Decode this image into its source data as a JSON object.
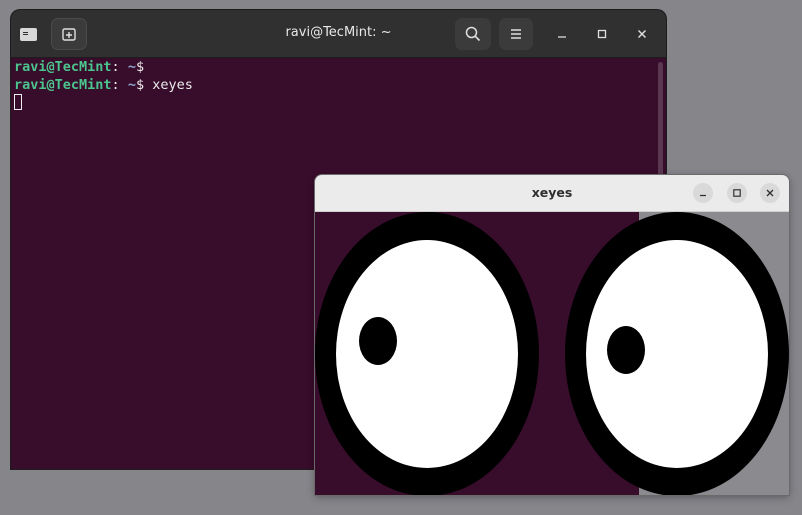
{
  "terminal": {
    "title": "ravi@TecMint: ~",
    "lines": [
      {
        "user": "ravi@TecMint",
        "sep": ":",
        "dir": " ~",
        "symbol": "$",
        "command": ""
      },
      {
        "user": "ravi@TecMint",
        "sep": ":",
        "dir": " ~",
        "symbol": "$",
        "command": " xeyes"
      }
    ],
    "icons": {
      "app": "terminal-icon",
      "new_tab": "new-tab-icon",
      "search": "search-icon",
      "menu": "hamburger-menu-icon",
      "minimize": "minimize-icon",
      "maximize": "maximize-icon",
      "close": "close-icon"
    },
    "colors": {
      "background": "#380c2b",
      "prompt_user": "#4cc48d",
      "prompt_dir": "#8da8d0"
    }
  },
  "xeyes": {
    "title": "xeyes",
    "icons": {
      "minimize": "minimize-icon",
      "maximize": "maximize-icon",
      "close": "close-icon"
    }
  },
  "desktop": {
    "background": "#86858a"
  }
}
